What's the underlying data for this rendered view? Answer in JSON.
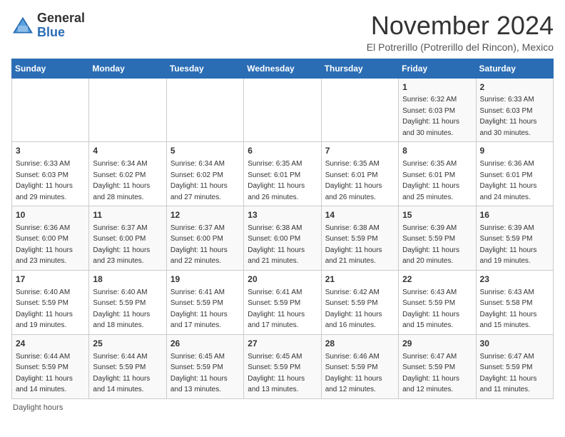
{
  "header": {
    "logo_general": "General",
    "logo_blue": "Blue",
    "month_title": "November 2024",
    "location": "El Potrerillo (Potrerillo del Rincon), Mexico"
  },
  "days_of_week": [
    "Sunday",
    "Monday",
    "Tuesday",
    "Wednesday",
    "Thursday",
    "Friday",
    "Saturday"
  ],
  "footer_text": "Daylight hours",
  "weeks": [
    [
      {
        "num": "",
        "sunrise": "",
        "sunset": "",
        "daylight": ""
      },
      {
        "num": "",
        "sunrise": "",
        "sunset": "",
        "daylight": ""
      },
      {
        "num": "",
        "sunrise": "",
        "sunset": "",
        "daylight": ""
      },
      {
        "num": "",
        "sunrise": "",
        "sunset": "",
        "daylight": ""
      },
      {
        "num": "",
        "sunrise": "",
        "sunset": "",
        "daylight": ""
      },
      {
        "num": "1",
        "sunrise": "Sunrise: 6:32 AM",
        "sunset": "Sunset: 6:03 PM",
        "daylight": "Daylight: 11 hours and 30 minutes."
      },
      {
        "num": "2",
        "sunrise": "Sunrise: 6:33 AM",
        "sunset": "Sunset: 6:03 PM",
        "daylight": "Daylight: 11 hours and 30 minutes."
      }
    ],
    [
      {
        "num": "3",
        "sunrise": "Sunrise: 6:33 AM",
        "sunset": "Sunset: 6:03 PM",
        "daylight": "Daylight: 11 hours and 29 minutes."
      },
      {
        "num": "4",
        "sunrise": "Sunrise: 6:34 AM",
        "sunset": "Sunset: 6:02 PM",
        "daylight": "Daylight: 11 hours and 28 minutes."
      },
      {
        "num": "5",
        "sunrise": "Sunrise: 6:34 AM",
        "sunset": "Sunset: 6:02 PM",
        "daylight": "Daylight: 11 hours and 27 minutes."
      },
      {
        "num": "6",
        "sunrise": "Sunrise: 6:35 AM",
        "sunset": "Sunset: 6:01 PM",
        "daylight": "Daylight: 11 hours and 26 minutes."
      },
      {
        "num": "7",
        "sunrise": "Sunrise: 6:35 AM",
        "sunset": "Sunset: 6:01 PM",
        "daylight": "Daylight: 11 hours and 26 minutes."
      },
      {
        "num": "8",
        "sunrise": "Sunrise: 6:35 AM",
        "sunset": "Sunset: 6:01 PM",
        "daylight": "Daylight: 11 hours and 25 minutes."
      },
      {
        "num": "9",
        "sunrise": "Sunrise: 6:36 AM",
        "sunset": "Sunset: 6:01 PM",
        "daylight": "Daylight: 11 hours and 24 minutes."
      }
    ],
    [
      {
        "num": "10",
        "sunrise": "Sunrise: 6:36 AM",
        "sunset": "Sunset: 6:00 PM",
        "daylight": "Daylight: 11 hours and 23 minutes."
      },
      {
        "num": "11",
        "sunrise": "Sunrise: 6:37 AM",
        "sunset": "Sunset: 6:00 PM",
        "daylight": "Daylight: 11 hours and 23 minutes."
      },
      {
        "num": "12",
        "sunrise": "Sunrise: 6:37 AM",
        "sunset": "Sunset: 6:00 PM",
        "daylight": "Daylight: 11 hours and 22 minutes."
      },
      {
        "num": "13",
        "sunrise": "Sunrise: 6:38 AM",
        "sunset": "Sunset: 6:00 PM",
        "daylight": "Daylight: 11 hours and 21 minutes."
      },
      {
        "num": "14",
        "sunrise": "Sunrise: 6:38 AM",
        "sunset": "Sunset: 5:59 PM",
        "daylight": "Daylight: 11 hours and 21 minutes."
      },
      {
        "num": "15",
        "sunrise": "Sunrise: 6:39 AM",
        "sunset": "Sunset: 5:59 PM",
        "daylight": "Daylight: 11 hours and 20 minutes."
      },
      {
        "num": "16",
        "sunrise": "Sunrise: 6:39 AM",
        "sunset": "Sunset: 5:59 PM",
        "daylight": "Daylight: 11 hours and 19 minutes."
      }
    ],
    [
      {
        "num": "17",
        "sunrise": "Sunrise: 6:40 AM",
        "sunset": "Sunset: 5:59 PM",
        "daylight": "Daylight: 11 hours and 19 minutes."
      },
      {
        "num": "18",
        "sunrise": "Sunrise: 6:40 AM",
        "sunset": "Sunset: 5:59 PM",
        "daylight": "Daylight: 11 hours and 18 minutes."
      },
      {
        "num": "19",
        "sunrise": "Sunrise: 6:41 AM",
        "sunset": "Sunset: 5:59 PM",
        "daylight": "Daylight: 11 hours and 17 minutes."
      },
      {
        "num": "20",
        "sunrise": "Sunrise: 6:41 AM",
        "sunset": "Sunset: 5:59 PM",
        "daylight": "Daylight: 11 hours and 17 minutes."
      },
      {
        "num": "21",
        "sunrise": "Sunrise: 6:42 AM",
        "sunset": "Sunset: 5:59 PM",
        "daylight": "Daylight: 11 hours and 16 minutes."
      },
      {
        "num": "22",
        "sunrise": "Sunrise: 6:43 AM",
        "sunset": "Sunset: 5:59 PM",
        "daylight": "Daylight: 11 hours and 15 minutes."
      },
      {
        "num": "23",
        "sunrise": "Sunrise: 6:43 AM",
        "sunset": "Sunset: 5:58 PM",
        "daylight": "Daylight: 11 hours and 15 minutes."
      }
    ],
    [
      {
        "num": "24",
        "sunrise": "Sunrise: 6:44 AM",
        "sunset": "Sunset: 5:59 PM",
        "daylight": "Daylight: 11 hours and 14 minutes."
      },
      {
        "num": "25",
        "sunrise": "Sunrise: 6:44 AM",
        "sunset": "Sunset: 5:59 PM",
        "daylight": "Daylight: 11 hours and 14 minutes."
      },
      {
        "num": "26",
        "sunrise": "Sunrise: 6:45 AM",
        "sunset": "Sunset: 5:59 PM",
        "daylight": "Daylight: 11 hours and 13 minutes."
      },
      {
        "num": "27",
        "sunrise": "Sunrise: 6:45 AM",
        "sunset": "Sunset: 5:59 PM",
        "daylight": "Daylight: 11 hours and 13 minutes."
      },
      {
        "num": "28",
        "sunrise": "Sunrise: 6:46 AM",
        "sunset": "Sunset: 5:59 PM",
        "daylight": "Daylight: 11 hours and 12 minutes."
      },
      {
        "num": "29",
        "sunrise": "Sunrise: 6:47 AM",
        "sunset": "Sunset: 5:59 PM",
        "daylight": "Daylight: 11 hours and 12 minutes."
      },
      {
        "num": "30",
        "sunrise": "Sunrise: 6:47 AM",
        "sunset": "Sunset: 5:59 PM",
        "daylight": "Daylight: 11 hours and 11 minutes."
      }
    ]
  ]
}
